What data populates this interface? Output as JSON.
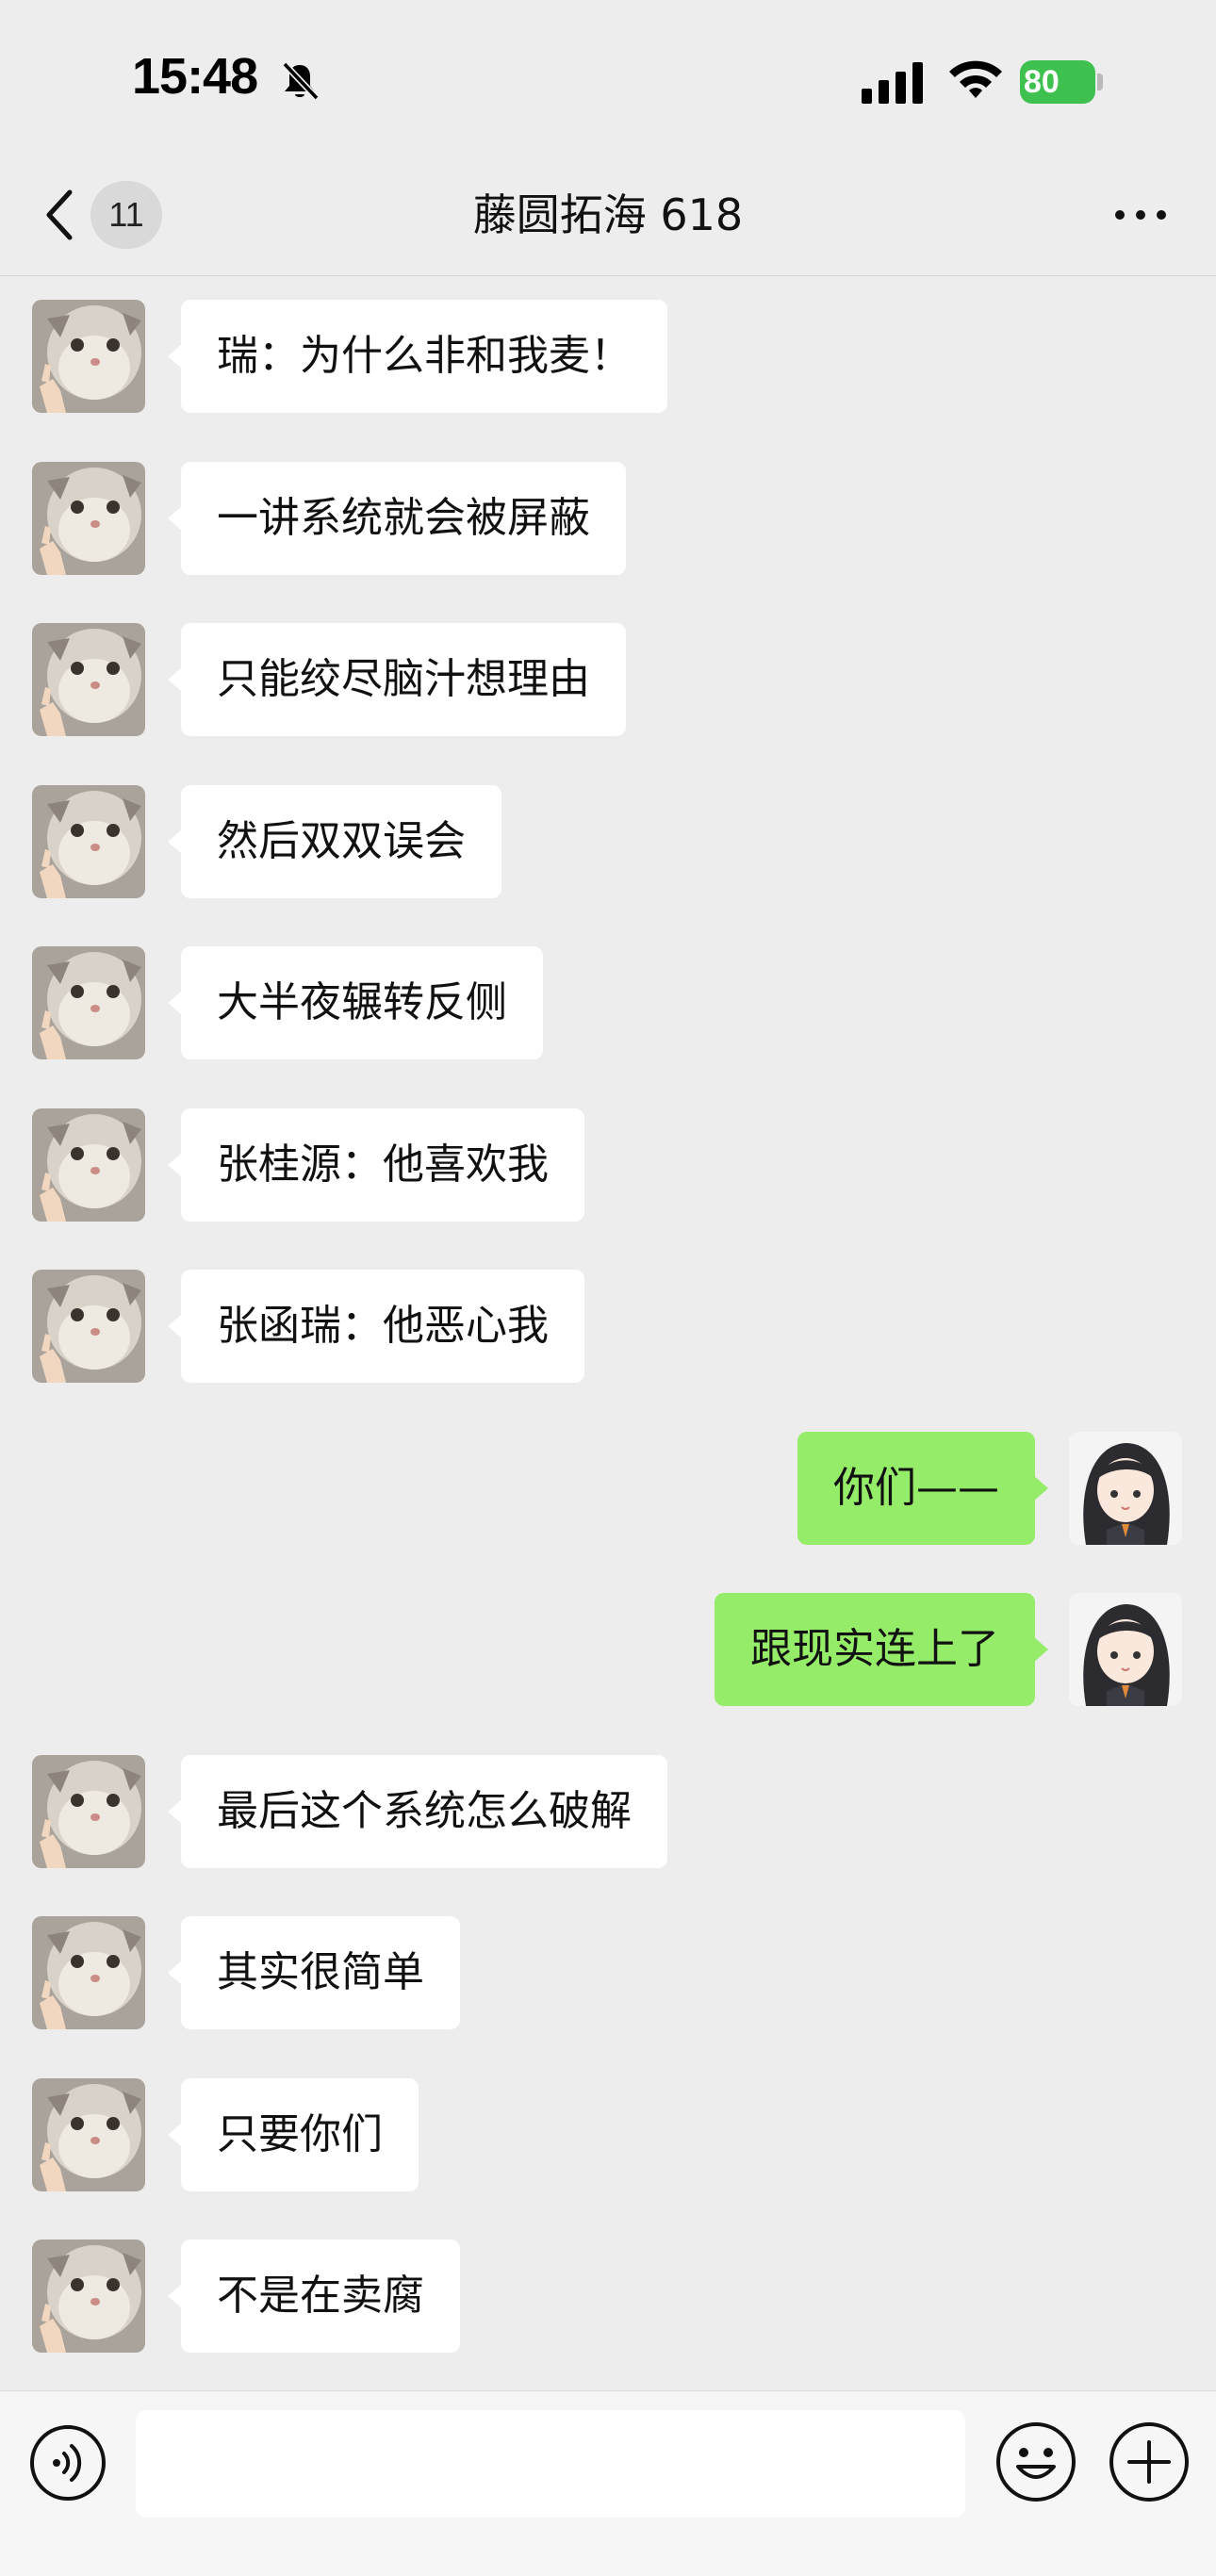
{
  "status_bar": {
    "time": "15:48",
    "battery": "80",
    "icons": [
      "bell-muted-icon",
      "signal-icon",
      "wifi-icon",
      "battery-charging-icon"
    ]
  },
  "nav": {
    "back_icon": "chevron-left-icon",
    "unread_count": "11",
    "title": "藤圆拓海 618",
    "more_icon": "ellipsis-icon"
  },
  "messages": [
    {
      "side": "left",
      "text": "瑞：为什么非和我麦！"
    },
    {
      "side": "left",
      "text": "一讲系统就会被屏蔽"
    },
    {
      "side": "left",
      "text": "只能绞尽脑汁想理由"
    },
    {
      "side": "left",
      "text": "然后双双误会"
    },
    {
      "side": "left",
      "text": "大半夜辗转反侧"
    },
    {
      "side": "left",
      "text": "张桂源：他喜欢我"
    },
    {
      "side": "left",
      "text": "张函瑞：他恶心我"
    },
    {
      "side": "right",
      "text": "你们——"
    },
    {
      "side": "right",
      "text": "跟现实连上了"
    },
    {
      "side": "left",
      "text": "最后这个系统怎么破解"
    },
    {
      "side": "left",
      "text": "其实很简单"
    },
    {
      "side": "left",
      "text": "只要你们"
    },
    {
      "side": "left",
      "text": "不是在卖腐"
    }
  ],
  "input_bar": {
    "voice_icon": "voice-icon",
    "input_value": "",
    "emoji_icon": "emoji-icon",
    "plus_icon": "plus-icon"
  },
  "colors": {
    "background": "#ededed",
    "incoming_bubble": "#ffffff",
    "outgoing_bubble": "#95ec69",
    "battery": "#3ec14f"
  }
}
